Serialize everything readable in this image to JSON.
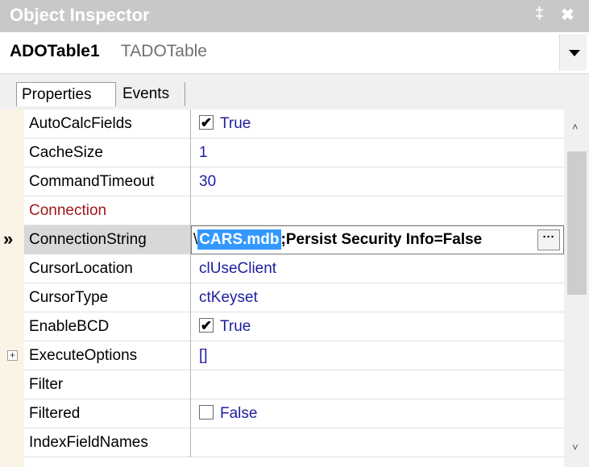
{
  "window": {
    "title": "Object Inspector",
    "pin_glyph": "📌",
    "close_glyph": "✖"
  },
  "component": {
    "name": "ADOTable1",
    "type": "TADOTable"
  },
  "tabs": [
    {
      "label": "Properties",
      "active": true
    },
    {
      "label": "Events",
      "active": false
    }
  ],
  "properties": [
    {
      "name": "AutoCalcFields",
      "kind": "bool",
      "checked": true,
      "value": "True"
    },
    {
      "name": "CacheSize",
      "kind": "text",
      "value": "1"
    },
    {
      "name": "CommandTimeout",
      "kind": "text",
      "value": "30"
    },
    {
      "name": "Connection",
      "kind": "ref",
      "value": ""
    },
    {
      "name": "ConnectionString",
      "kind": "edit",
      "selected": true,
      "value_prefix": "\\",
      "value_selected": "CARS.mdb",
      "value_suffix": ";Persist Security Info=False"
    },
    {
      "name": "CursorLocation",
      "kind": "text",
      "value": "clUseClient"
    },
    {
      "name": "CursorType",
      "kind": "text",
      "value": "ctKeyset"
    },
    {
      "name": "EnableBCD",
      "kind": "bool",
      "checked": true,
      "value": "True"
    },
    {
      "name": "ExecuteOptions",
      "kind": "set",
      "value": "[]"
    },
    {
      "name": "Filter",
      "kind": "text",
      "value": ""
    },
    {
      "name": "Filtered",
      "kind": "bool",
      "checked": false,
      "value": "False"
    },
    {
      "name": "IndexFieldNames",
      "kind": "text",
      "value": ""
    }
  ],
  "icons": {
    "selected_marker": "»",
    "ellipsis": "···",
    "check": "✔",
    "expand": "+",
    "scroll_up": "˄",
    "scroll_down": "˅"
  },
  "colors": {
    "value_text": "#1e1ea0",
    "reference_name": "#a01818",
    "selection": "#3399ff"
  }
}
